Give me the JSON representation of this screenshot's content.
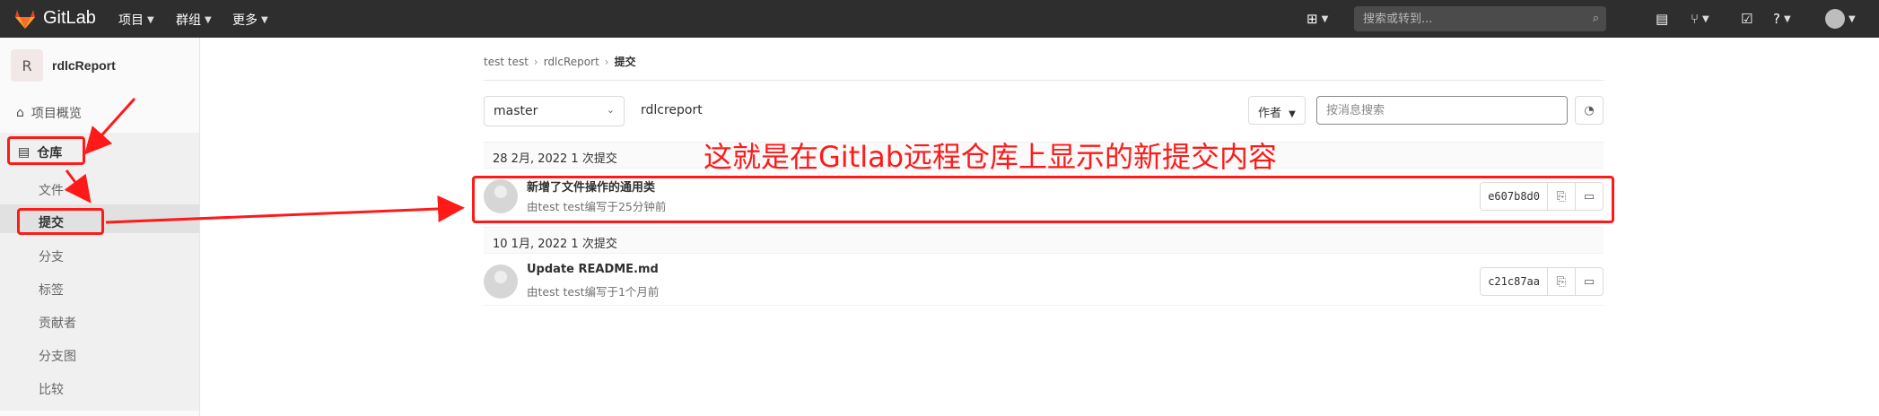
{
  "topbar": {
    "brand": "GitLab",
    "menus": [
      {
        "label": "项目"
      },
      {
        "label": "群组"
      },
      {
        "label": "更多"
      }
    ],
    "search_placeholder": "搜索或转到..."
  },
  "sidebar": {
    "project_initial": "R",
    "project_name": "rdlcReport",
    "overview": "项目概览",
    "repository": "仓库",
    "sub_items": [
      "文件",
      "提交",
      "分支",
      "标签",
      "贡献者",
      "分支图",
      "比较"
    ]
  },
  "breadcrumb": [
    "test test",
    "rdlcReport",
    "提交"
  ],
  "toolbar": {
    "branch": "master",
    "path": "rdlcreport",
    "author_label": "作者",
    "filter_placeholder": "按消息搜索"
  },
  "commit_groups": [
    {
      "day": "28 2月, 2022 1 次提交",
      "commits": [
        {
          "title": "新增了文件操作的通用类",
          "meta": "由test test编写于25分钟前",
          "sha": "e607b8d0"
        }
      ]
    },
    {
      "day": "10 1月, 2022 1 次提交",
      "commits": [
        {
          "title": "Update README.md",
          "meta": "由test test编写于1个月前",
          "sha": "c21c87aa"
        }
      ]
    }
  ],
  "annotation": "这就是在Gitlab远程仓库上显示的新提交内容",
  "colors": {
    "annotation": "#ff1a1a",
    "topbar": "#2e2e2e"
  }
}
